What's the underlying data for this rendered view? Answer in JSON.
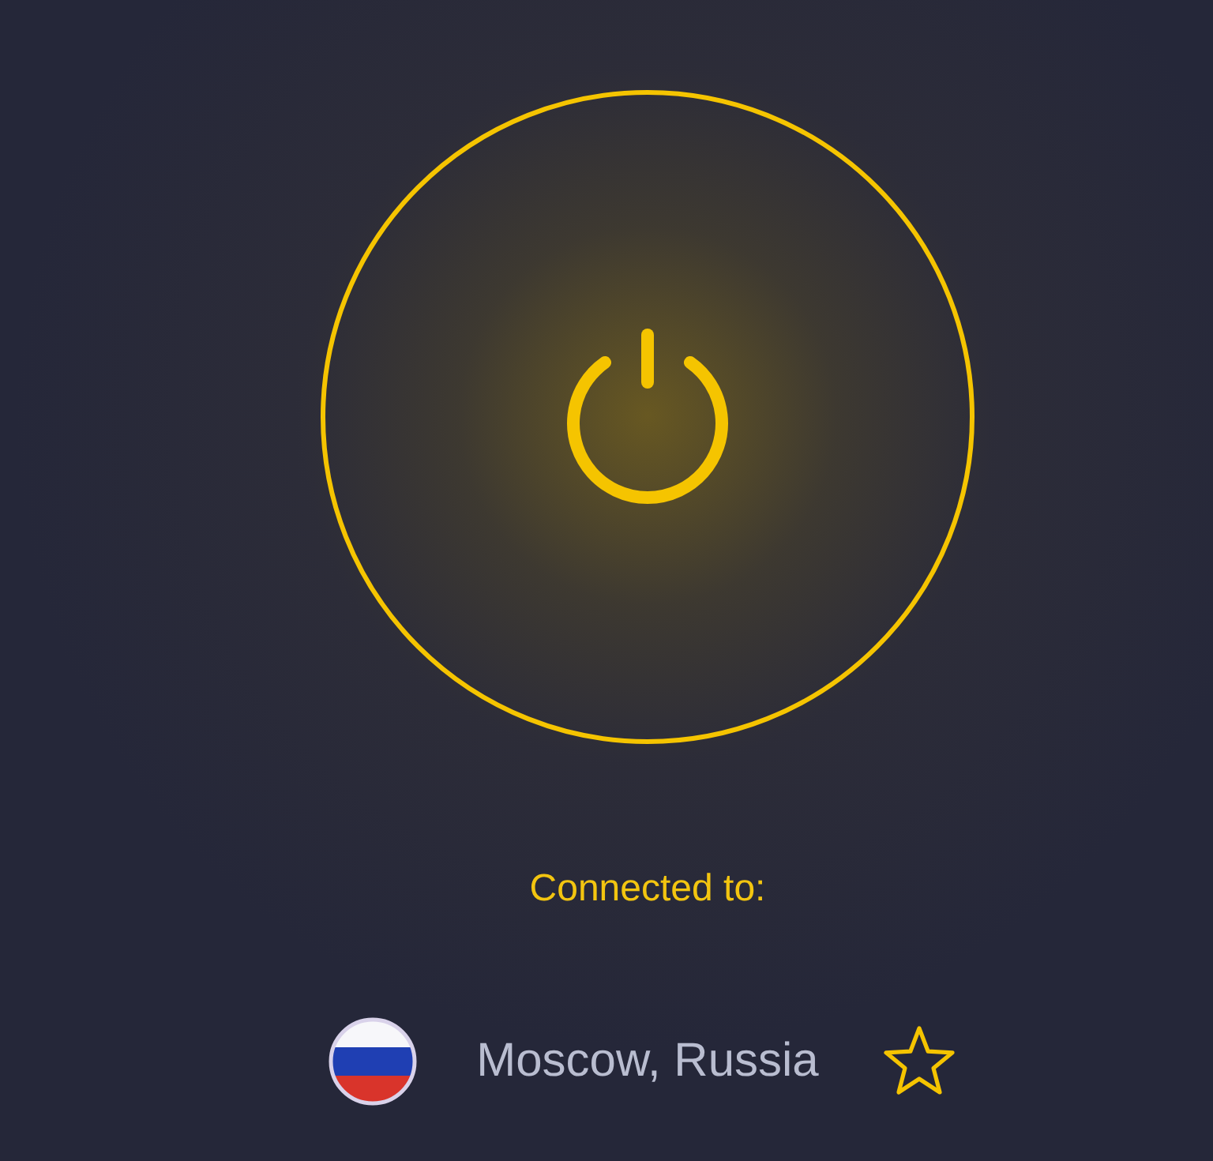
{
  "power_button": {
    "connected": true
  },
  "status": {
    "label": "Connected to:"
  },
  "location": {
    "city": "Moscow, Russia",
    "favorite": false
  }
}
